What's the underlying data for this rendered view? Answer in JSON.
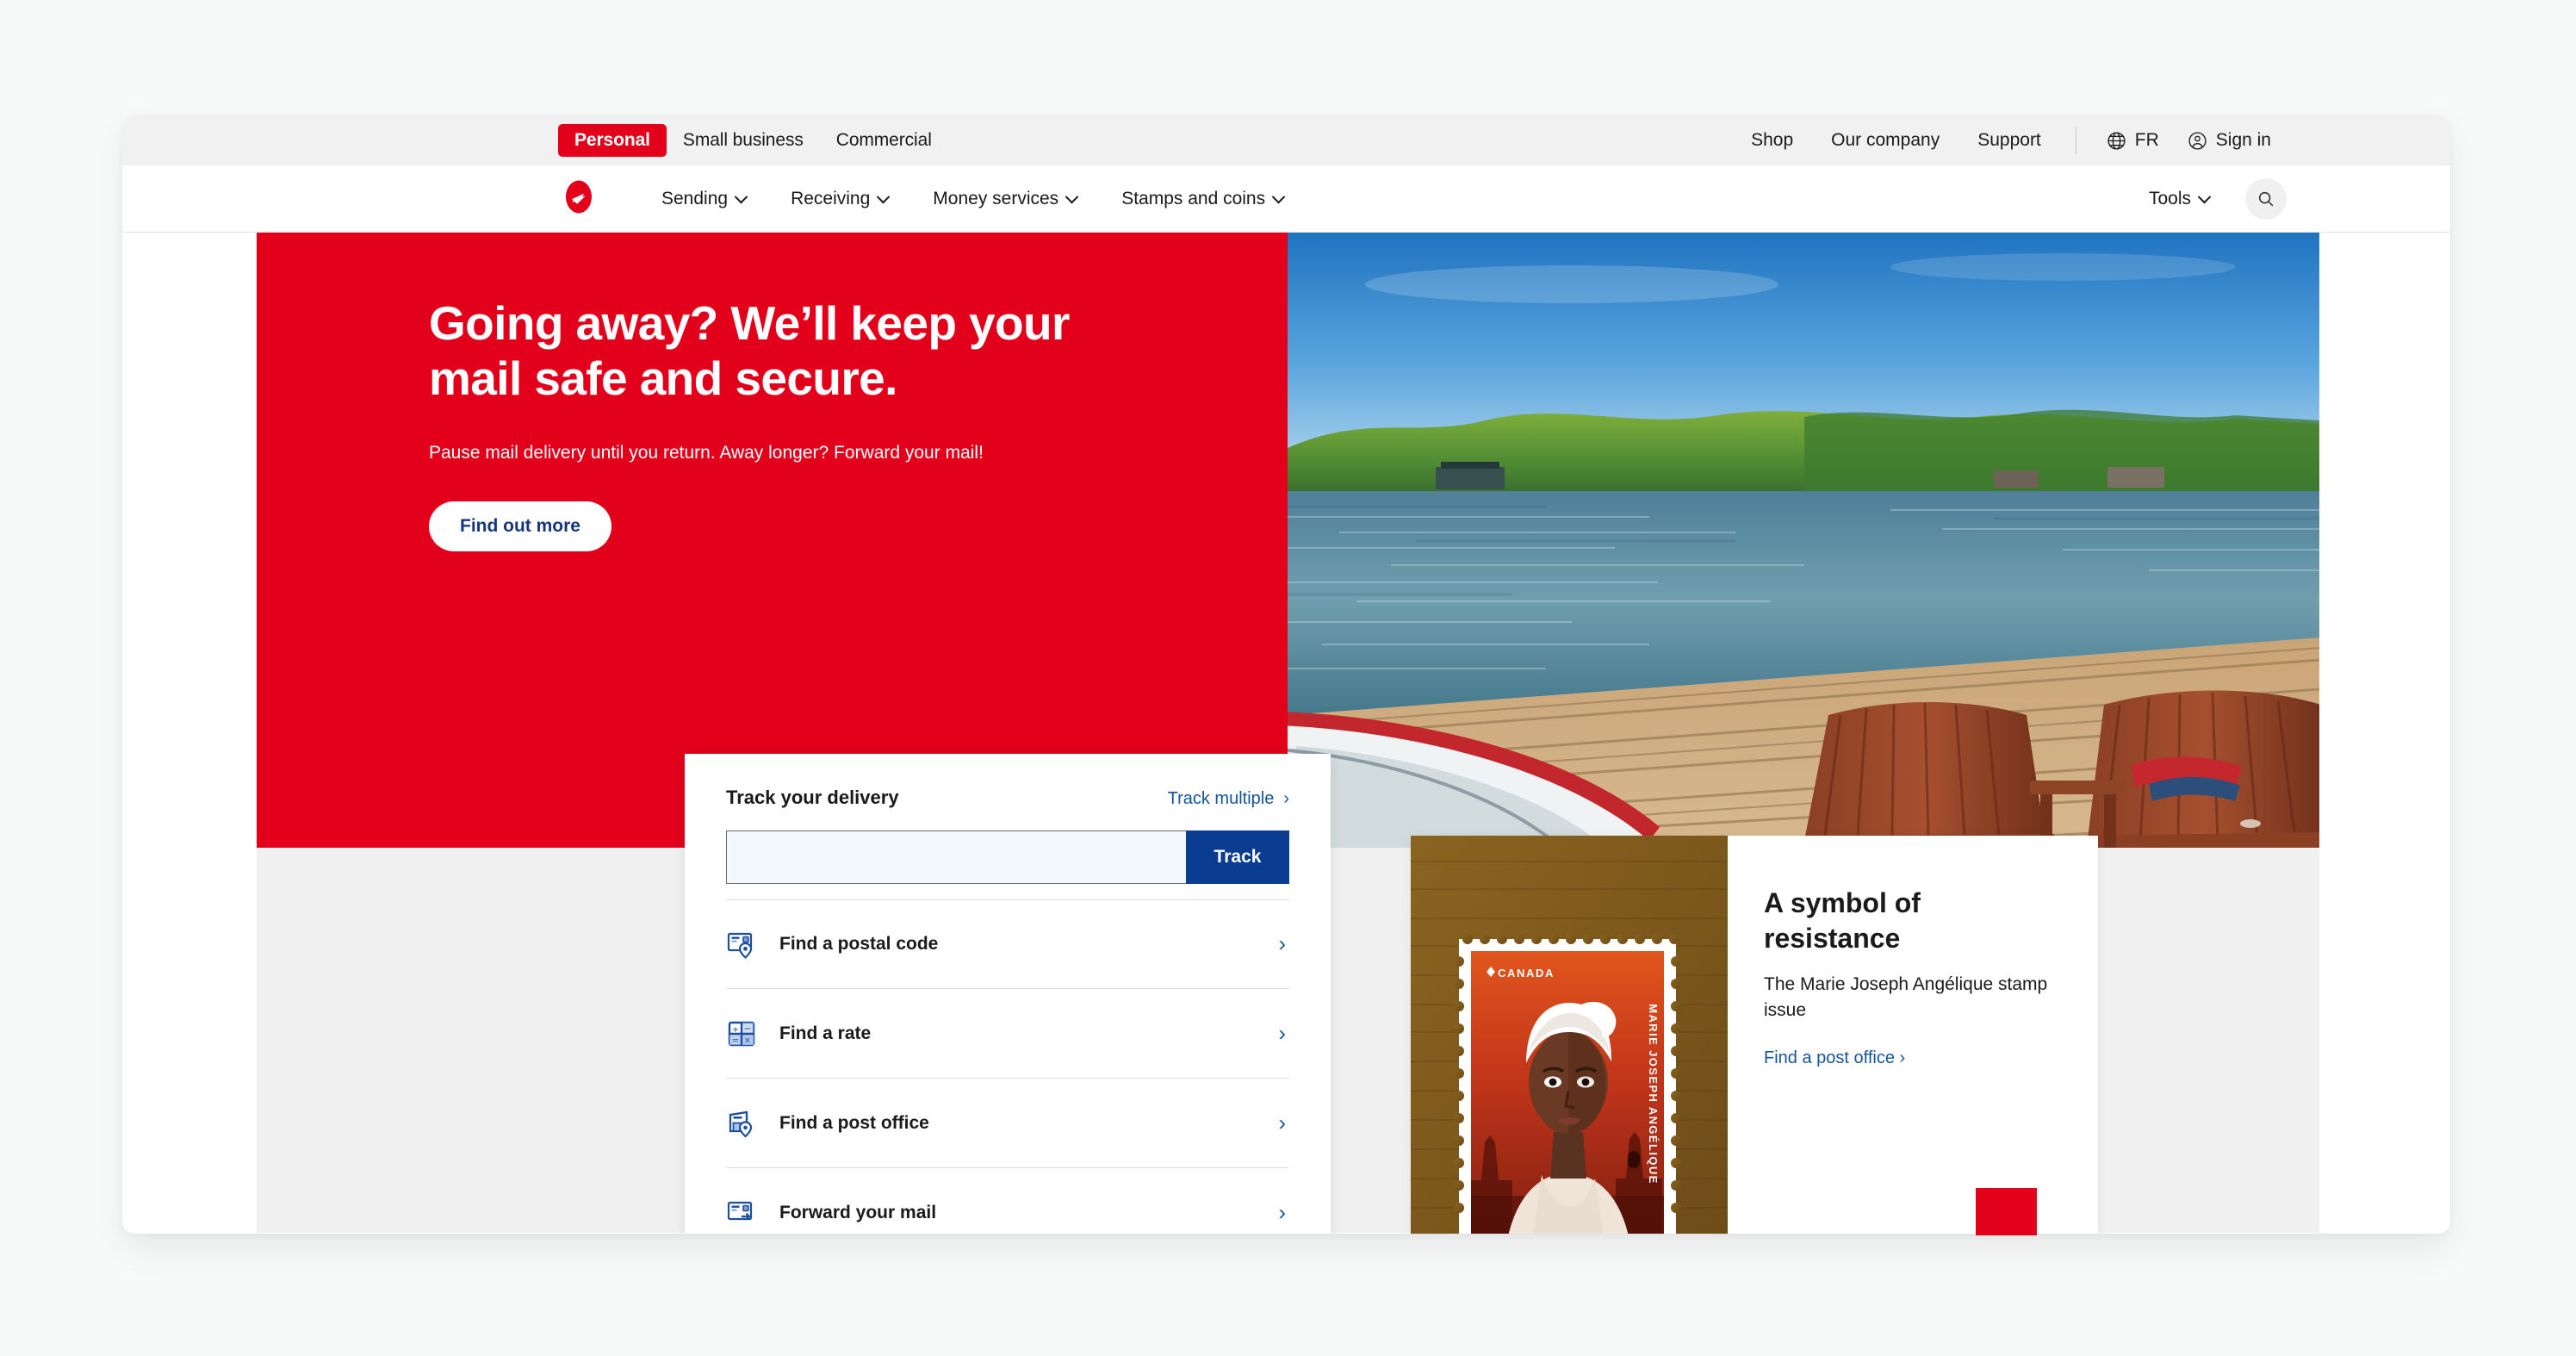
{
  "utility_bar": {
    "audience_tabs": [
      {
        "label": "Personal",
        "active": true
      },
      {
        "label": "Small business",
        "active": false
      },
      {
        "label": "Commercial",
        "active": false
      }
    ],
    "links": [
      "Shop",
      "Our company",
      "Support"
    ],
    "language": {
      "label": "FR",
      "icon": "globe-icon"
    },
    "account": {
      "label": "Sign in",
      "icon": "user-circle-icon"
    }
  },
  "main_nav": {
    "logo": "canada-post-logo",
    "items": [
      {
        "label": "Sending"
      },
      {
        "label": "Receiving"
      },
      {
        "label": "Money services"
      },
      {
        "label": "Stamps and coins"
      }
    ],
    "tools": {
      "label": "Tools"
    },
    "search": {
      "icon": "search-icon"
    }
  },
  "hero": {
    "title": "Going away? We’ll keep your mail safe and secure.",
    "subtitle": "Pause mail delivery until you return. Away longer? Forward your mail!",
    "cta": "Find out more",
    "image_alt": "Two Adirondack chairs and a canoe on a lakeside dock"
  },
  "track_card": {
    "title": "Track your delivery",
    "track_multiple": "Track multiple",
    "input_value": "",
    "input_placeholder": "",
    "submit_label": "Track",
    "links": [
      {
        "label": "Find a postal code",
        "icon": "envelope-pin-icon"
      },
      {
        "label": "Find a rate",
        "icon": "calculator-icon"
      },
      {
        "label": "Find a post office",
        "icon": "building-pin-icon"
      },
      {
        "label": "Forward your mail",
        "icon": "envelope-icon"
      }
    ]
  },
  "stamp_card": {
    "title": "A symbol of resistance",
    "description": "The Marie Joseph Angélique stamp issue",
    "link": "Find a post office ›",
    "stamp_country": "CANADA",
    "stamp_caption": "MARIE JOSEPH ANGÉLIQUE"
  },
  "colors": {
    "brand_red": "#e2001a",
    "link_blue": "#14549c",
    "button_blue": "#0a3d91",
    "cta_text_blue": "#14377d",
    "page_bg": "#f0f0f0"
  }
}
